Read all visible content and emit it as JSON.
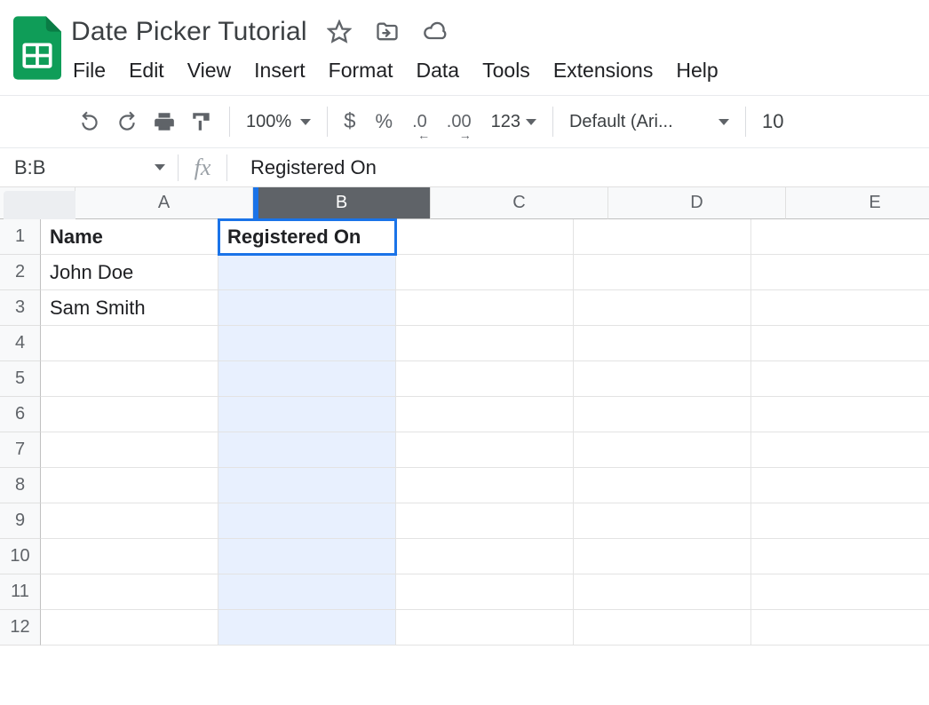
{
  "doc": {
    "title": "Date Picker Tutorial"
  },
  "menu": {
    "file": "File",
    "edit": "Edit",
    "view": "View",
    "insert": "Insert",
    "format": "Format",
    "data": "Data",
    "tools": "Tools",
    "extensions": "Extensions",
    "help": "Help"
  },
  "toolbar": {
    "zoom": "100%",
    "currency": "$",
    "percent": "%",
    "dec_dec": ".0",
    "dec_inc": ".00",
    "more_formats": "123",
    "font": "Default (Ari...",
    "font_size": "10"
  },
  "namebox": "B:B",
  "formula": "Registered On",
  "columns": [
    "A",
    "B",
    "C",
    "D",
    "E"
  ],
  "selected_column_index": 1,
  "rows": [
    {
      "n": "1",
      "cells": [
        "Name",
        "Registered On",
        "",
        "",
        ""
      ],
      "bold": true
    },
    {
      "n": "2",
      "cells": [
        "John Doe",
        "",
        "",
        "",
        ""
      ]
    },
    {
      "n": "3",
      "cells": [
        "Sam Smith",
        "",
        "",
        "",
        ""
      ]
    },
    {
      "n": "4",
      "cells": [
        "",
        "",
        "",
        "",
        ""
      ]
    },
    {
      "n": "5",
      "cells": [
        "",
        "",
        "",
        "",
        ""
      ]
    },
    {
      "n": "6",
      "cells": [
        "",
        "",
        "",
        "",
        ""
      ]
    },
    {
      "n": "7",
      "cells": [
        "",
        "",
        "",
        "",
        ""
      ]
    },
    {
      "n": "8",
      "cells": [
        "",
        "",
        "",
        "",
        ""
      ]
    },
    {
      "n": "9",
      "cells": [
        "",
        "",
        "",
        "",
        ""
      ]
    },
    {
      "n": "10",
      "cells": [
        "",
        "",
        "",
        "",
        ""
      ]
    },
    {
      "n": "11",
      "cells": [
        "",
        "",
        "",
        "",
        ""
      ]
    },
    {
      "n": "12",
      "cells": [
        "",
        "",
        "",
        "",
        ""
      ]
    }
  ]
}
